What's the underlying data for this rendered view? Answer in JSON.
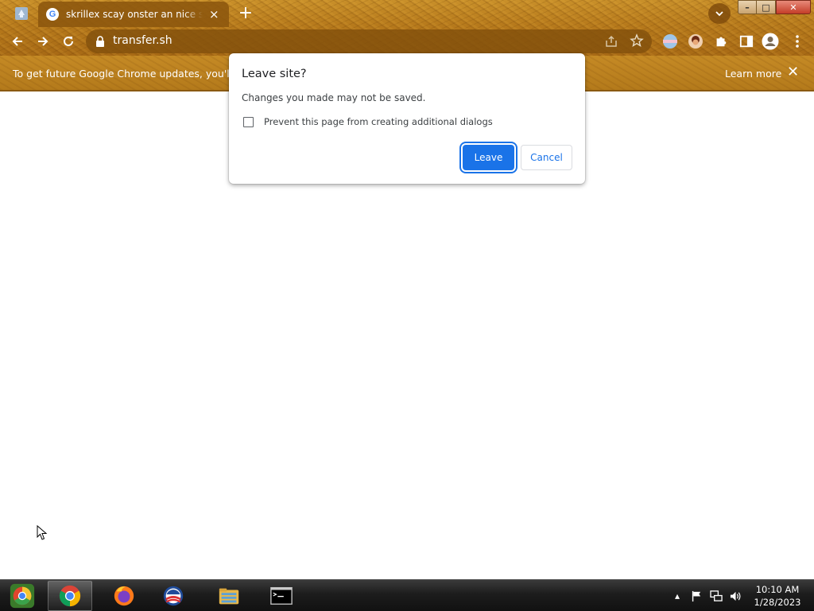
{
  "browser": {
    "tab": {
      "title": "skrillex scay onster an nice sprite",
      "favicon_letter": "G"
    },
    "new_tab_symbol": "+",
    "omnibox": {
      "url": "transfer.sh"
    }
  },
  "window_controls": {
    "minimize": "–",
    "maximize": "□",
    "close": "✕"
  },
  "infobar": {
    "message": "To get future Google Chrome updates, you'll need",
    "learn_more": "Learn more",
    "close": "✕"
  },
  "dialog": {
    "title": "Leave site?",
    "message": "Changes you made may not be saved.",
    "checkbox_label": "Prevent this page from creating additional dialogs",
    "checkbox_checked": false,
    "leave_label": "Leave",
    "cancel_label": "Cancel"
  },
  "taskbar": {
    "apps": [
      "start-orb",
      "chrome",
      "firefox",
      "obama-icon",
      "file-explorer",
      "command-prompt"
    ],
    "active_app": "chrome",
    "tray_expand": "▴"
  },
  "clock": {
    "time": "10:10 AM",
    "date": "1/28/2023"
  },
  "colors": {
    "theme_brown": "#b77a1c",
    "accent_blue": "#1a73e8",
    "taskbar": "#1d1d1d"
  }
}
